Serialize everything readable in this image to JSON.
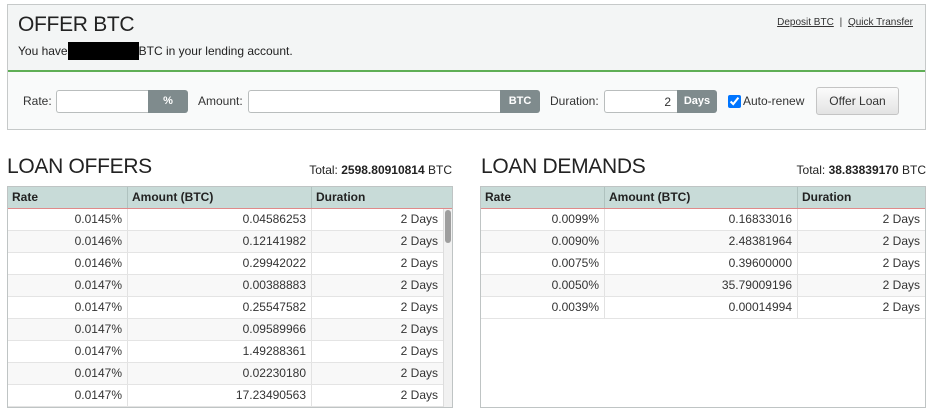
{
  "offer": {
    "title": "OFFER BTC",
    "balance_prefix": "You have",
    "balance_suffix": "BTC in your lending account.",
    "links": {
      "deposit": "Deposit BTC",
      "separator": "|",
      "quick_transfer": "Quick Transfer"
    },
    "form": {
      "rate": {
        "label": "Rate:",
        "unit": "%"
      },
      "amount": {
        "label": "Amount:",
        "unit": "BTC"
      },
      "duration": {
        "label": "Duration:",
        "value": "2",
        "unit": "Days"
      },
      "auto_renew": {
        "label": "Auto-renew",
        "checked": true
      },
      "submit_label": "Offer Loan"
    }
  },
  "loan_offers": {
    "title": "LOAN OFFERS",
    "total_label": "Total:",
    "total_value": "2598.80910814",
    "total_unit": "BTC",
    "columns": [
      "Rate",
      "Amount (BTC)",
      "Duration"
    ],
    "rows": [
      {
        "rate": "0.0145%",
        "amount": "0.04586253",
        "duration": "2 Days"
      },
      {
        "rate": "0.0146%",
        "amount": "0.12141982",
        "duration": "2 Days"
      },
      {
        "rate": "0.0146%",
        "amount": "0.29942022",
        "duration": "2 Days"
      },
      {
        "rate": "0.0147%",
        "amount": "0.00388883",
        "duration": "2 Days"
      },
      {
        "rate": "0.0147%",
        "amount": "0.25547582",
        "duration": "2 Days"
      },
      {
        "rate": "0.0147%",
        "amount": "0.09589966",
        "duration": "2 Days"
      },
      {
        "rate": "0.0147%",
        "amount": "1.49288361",
        "duration": "2 Days"
      },
      {
        "rate": "0.0147%",
        "amount": "0.02230180",
        "duration": "2 Days"
      },
      {
        "rate": "0.0147%",
        "amount": "17.23490563",
        "duration": "2 Days"
      }
    ]
  },
  "loan_demands": {
    "title": "LOAN DEMANDS",
    "total_label": "Total:",
    "total_value": "38.83839170",
    "total_unit": "BTC",
    "columns": [
      "Rate",
      "Amount (BTC)",
      "Duration"
    ],
    "rows": [
      {
        "rate": "0.0099%",
        "amount": "0.16833016",
        "duration": "2 Days"
      },
      {
        "rate": "0.0090%",
        "amount": "2.48381964",
        "duration": "2 Days"
      },
      {
        "rate": "0.0075%",
        "amount": "0.39600000",
        "duration": "2 Days"
      },
      {
        "rate": "0.0050%",
        "amount": "35.79009196",
        "duration": "2 Days"
      },
      {
        "rate": "0.0039%",
        "amount": "0.00014994",
        "duration": "2 Days"
      }
    ]
  },
  "colors": {
    "accent_green": "#5fae55",
    "table_header_bg": "#c8dbd8",
    "input_addon_bg": "#7f8b8d",
    "header_rule": "#e08a8a"
  }
}
